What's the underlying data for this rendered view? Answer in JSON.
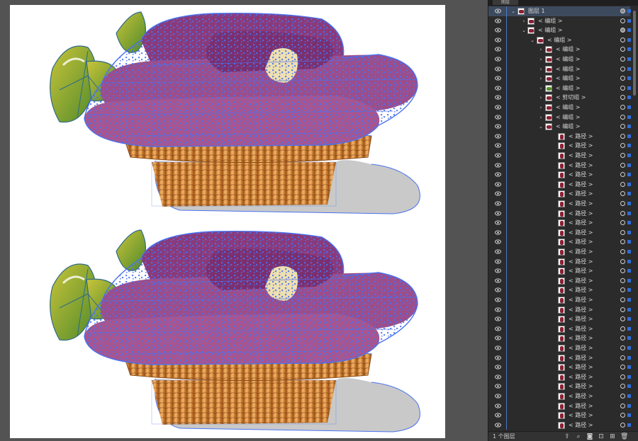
{
  "panel": {
    "tab_label": "图层",
    "layer_count": "1 个图层",
    "rows": [
      {
        "label": "图层 1",
        "depth": 0,
        "chevron": "v",
        "thumb": "group",
        "selected": true,
        "target_filled": true
      },
      {
        "label": "< 编组 >",
        "depth": 1,
        "chevron": ">",
        "thumb": "group",
        "target_filled": false
      },
      {
        "label": "< 编组 >",
        "depth": 1,
        "chevron": "v",
        "thumb": "group",
        "target_filled": true
      },
      {
        "label": "< 编组 >",
        "depth": 2,
        "chevron": "v",
        "thumb": "group",
        "target_filled": false
      },
      {
        "label": "< 编组 >",
        "depth": 3,
        "chevron": ">",
        "thumb": "group",
        "target_filled": false
      },
      {
        "label": "< 编组 >",
        "depth": 3,
        "chevron": ">",
        "thumb": "group",
        "target_filled": false
      },
      {
        "label": "< 编组 >",
        "depth": 3,
        "chevron": ">",
        "thumb": "group",
        "target_filled": false
      },
      {
        "label": "< 编组 >",
        "depth": 3,
        "chevron": ">",
        "thumb": "group",
        "target_filled": false
      },
      {
        "label": "< 编组 >",
        "depth": 3,
        "chevron": ">",
        "thumb": "leaf",
        "target_filled": false
      },
      {
        "label": "< 剪切组 >",
        "depth": 3,
        "chevron": ">",
        "thumb": "group",
        "target_filled": false
      },
      {
        "label": "< 编组 >",
        "depth": 3,
        "chevron": ">",
        "thumb": "group",
        "target_filled": false
      },
      {
        "label": "< 编组 >",
        "depth": 3,
        "chevron": ">",
        "thumb": "group",
        "target_filled": false
      },
      {
        "label": "< 编组 >",
        "depth": 3,
        "chevron": "v",
        "thumb": "group",
        "target_filled": false
      },
      {
        "label": "< 路径 >",
        "depth": 4,
        "chevron": "",
        "thumb": "path",
        "target_filled": false
      },
      {
        "label": "< 路径 >",
        "depth": 4,
        "chevron": "",
        "thumb": "path",
        "target_filled": false
      },
      {
        "label": "< 路径 >",
        "depth": 4,
        "chevron": "",
        "thumb": "path",
        "target_filled": false
      },
      {
        "label": "< 路径 >",
        "depth": 4,
        "chevron": "",
        "thumb": "path",
        "target_filled": false
      },
      {
        "label": "< 路径 >",
        "depth": 4,
        "chevron": "",
        "thumb": "path",
        "target_filled": false
      },
      {
        "label": "< 路径 >",
        "depth": 4,
        "chevron": "",
        "thumb": "path",
        "target_filled": false
      },
      {
        "label": "< 路径 >",
        "depth": 4,
        "chevron": "",
        "thumb": "path",
        "target_filled": false
      },
      {
        "label": "< 路径 >",
        "depth": 4,
        "chevron": "",
        "thumb": "path",
        "target_filled": false
      },
      {
        "label": "< 路径 >",
        "depth": 4,
        "chevron": "",
        "thumb": "path",
        "target_filled": false
      },
      {
        "label": "< 路径 >",
        "depth": 4,
        "chevron": "",
        "thumb": "path",
        "target_filled": false
      },
      {
        "label": "< 路径 >",
        "depth": 4,
        "chevron": "",
        "thumb": "path",
        "target_filled": false
      },
      {
        "label": "< 路径 >",
        "depth": 4,
        "chevron": "",
        "thumb": "path",
        "target_filled": false
      },
      {
        "label": "< 路径 >",
        "depth": 4,
        "chevron": "",
        "thumb": "path",
        "target_filled": false
      },
      {
        "label": "< 路径 >",
        "depth": 4,
        "chevron": "",
        "thumb": "path",
        "target_filled": false
      },
      {
        "label": "< 路径 >",
        "depth": 4,
        "chevron": "",
        "thumb": "path",
        "target_filled": false
      },
      {
        "label": "< 路径 >",
        "depth": 4,
        "chevron": "",
        "thumb": "path",
        "target_filled": false
      },
      {
        "label": "< 路径 >",
        "depth": 4,
        "chevron": "",
        "thumb": "path",
        "target_filled": false
      },
      {
        "label": "< 路径 >",
        "depth": 4,
        "chevron": "",
        "thumb": "path",
        "target_filled": false
      },
      {
        "label": "< 路径 >",
        "depth": 4,
        "chevron": "",
        "thumb": "path",
        "target_filled": false
      },
      {
        "label": "< 路径 >",
        "depth": 4,
        "chevron": "",
        "thumb": "path",
        "target_filled": false
      },
      {
        "label": "< 路径 >",
        "depth": 4,
        "chevron": "",
        "thumb": "path",
        "target_filled": false
      },
      {
        "label": "< 路径 >",
        "depth": 4,
        "chevron": "",
        "thumb": "path",
        "target_filled": false
      },
      {
        "label": "< 路径 >",
        "depth": 4,
        "chevron": "",
        "thumb": "path",
        "target_filled": false
      },
      {
        "label": "< 路径 >",
        "depth": 4,
        "chevron": "",
        "thumb": "path",
        "target_filled": false
      },
      {
        "label": "< 路径 >",
        "depth": 4,
        "chevron": "",
        "thumb": "path",
        "target_filled": false
      },
      {
        "label": "< 路径 >",
        "depth": 4,
        "chevron": "",
        "thumb": "path",
        "target_filled": false
      },
      {
        "label": "< 路径 >",
        "depth": 4,
        "chevron": "",
        "thumb": "path",
        "target_filled": false
      },
      {
        "label": "< 路径 >",
        "depth": 4,
        "chevron": "",
        "thumb": "path",
        "target_filled": false
      },
      {
        "label": "< 路径 >",
        "depth": 4,
        "chevron": "",
        "thumb": "path",
        "target_filled": false
      },
      {
        "label": "< 路径 >",
        "depth": 4,
        "chevron": "",
        "thumb": "path",
        "target_filled": false
      },
      {
        "label": "< 路径 >",
        "depth": 4,
        "chevron": "",
        "thumb": "path",
        "target_filled": false
      }
    ]
  },
  "colors": {
    "selection": "#4a72f0",
    "sweet_potato": "#8a3a7a",
    "sweet_potato_light": "#a8558f",
    "basket": "#d88a3a",
    "leaf": "#8fa83a",
    "shadow": "#c8c8c8",
    "panel_bg": "#2b2b2b",
    "selected_row": "#3d4a5e"
  },
  "icons": {
    "visibility": "eye-icon",
    "target": "target-circle-icon",
    "selection": "selection-square-icon",
    "expand": "chevron-right-icon",
    "collapse": "chevron-down-icon"
  }
}
